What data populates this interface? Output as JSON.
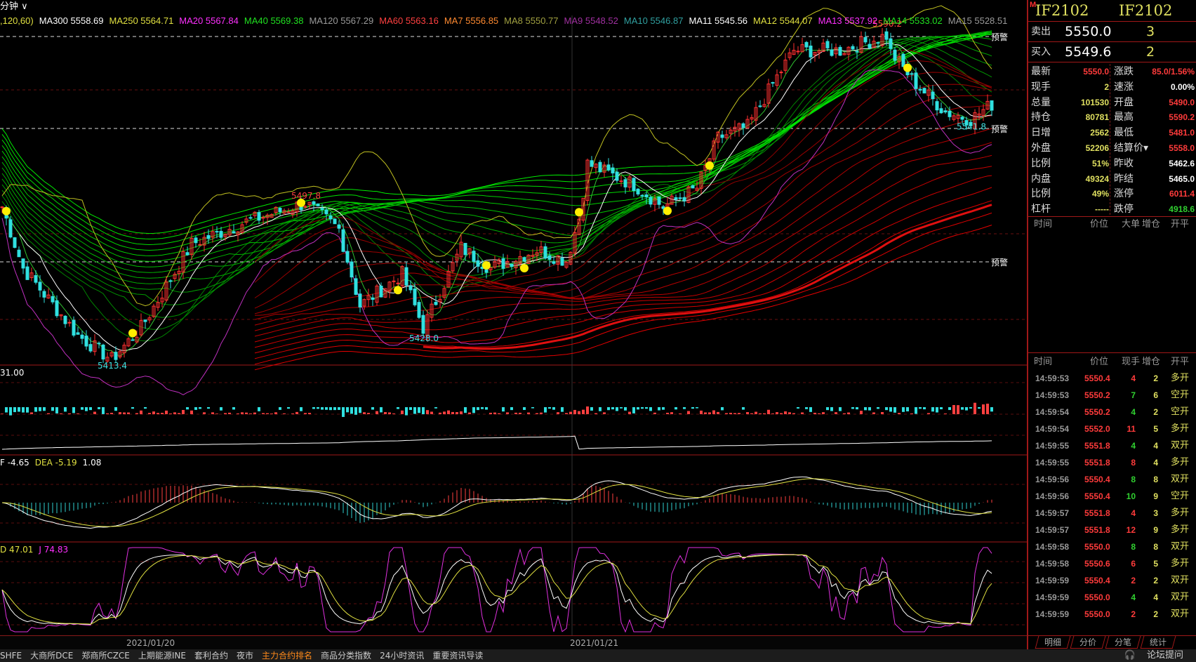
{
  "header": {
    "period": "分钟",
    "period_params": ",120,60)"
  },
  "ma_legend": [
    {
      "label": "MA300 5558.69",
      "color": "#ffffff"
    },
    {
      "label": "MA250 5564.71",
      "color": "#e0e040"
    },
    {
      "label": "MA20 5567.84",
      "color": "#ff30ff"
    },
    {
      "label": "MA40 5569.38",
      "color": "#20e020"
    },
    {
      "label": "MA120 5567.29",
      "color": "#9a9a9a"
    },
    {
      "label": "MA60 5563.16",
      "color": "#ff4040"
    },
    {
      "label": "MA7 5556.85",
      "color": "#ff8a30"
    },
    {
      "label": "MA8 5550.77",
      "color": "#a0a040"
    },
    {
      "label": "MA9 5548.52",
      "color": "#a030a0"
    },
    {
      "label": "MA10 5546.87",
      "color": "#30a0a0"
    },
    {
      "label": "MA11 5545.56",
      "color": "#ffffff"
    },
    {
      "label": "MA12 5544.07",
      "color": "#e0e040"
    },
    {
      "label": "MA13 5537.92",
      "color": "#ff30ff"
    },
    {
      "label": "MA14 5533.02",
      "color": "#20e020"
    },
    {
      "label": "MA15 5528.51",
      "color": "#9a9a9a"
    }
  ],
  "chart_data": {
    "type": "candlestick",
    "anchors": [
      [
        0,
        5495
      ],
      [
        5,
        5462
      ],
      [
        18,
        5426
      ],
      [
        26,
        5413
      ],
      [
        33,
        5430
      ],
      [
        45,
        5475
      ],
      [
        58,
        5487
      ],
      [
        72,
        5497
      ],
      [
        80,
        5483
      ],
      [
        85,
        5442
      ],
      [
        95,
        5459
      ],
      [
        100,
        5430
      ],
      [
        109,
        5473
      ],
      [
        116,
        5462
      ],
      [
        127,
        5472
      ],
      [
        134,
        5466
      ],
      [
        137,
        5489
      ],
      [
        139,
        5518
      ],
      [
        150,
        5507
      ],
      [
        157,
        5495
      ],
      [
        165,
        5505
      ],
      [
        170,
        5532
      ],
      [
        177,
        5538
      ],
      [
        183,
        5561
      ],
      [
        188,
        5579
      ],
      [
        199,
        5579
      ],
      [
        210,
        5587
      ],
      [
        211,
        5578
      ],
      [
        217,
        5561
      ],
      [
        224,
        5546
      ],
      [
        230,
        5542
      ],
      [
        235,
        5550
      ]
    ],
    "price_range": [
      5400,
      5600
    ],
    "annotations": [
      "5590.2",
      "5497.8",
      "5428.0",
      "5413.4",
      "5541.8"
    ],
    "alerts": [
      "预警",
      "预警",
      "预警"
    ],
    "dates": [
      "2021/01/20",
      "2021/01/21"
    ],
    "volume_label": "31.00",
    "macd_label": [
      {
        "t": "F -4.65",
        "c": "#ffffff"
      },
      {
        "t": "DEA -5.19",
        "c": "#e0e040"
      },
      {
        "t": "1.08",
        "c": "#ffffff"
      }
    ],
    "kdj_label": [
      {
        "t": "D 47.01",
        "c": "#e0e040"
      },
      {
        "t": "J 74.83",
        "c": "#ff30ff"
      }
    ]
  },
  "right_panel": {
    "marker": "M",
    "code1": "IF2102",
    "code2": "IF2102",
    "sell": {
      "label": "卖出",
      "price": "5550.0",
      "vol": "3"
    },
    "buy": {
      "label": "买入",
      "price": "5549.6",
      "vol": "2"
    },
    "info": [
      {
        "a": "最新",
        "b": "5550.0",
        "bc": "#ff3b3b",
        "c": "涨跌",
        "d": "85.0/1.56%",
        "dc": "#ff3b3b"
      },
      {
        "a": "现手",
        "b": "2",
        "bc": "#e0e060",
        "c": "速涨",
        "d": "0.00%",
        "dc": "#ffffff"
      },
      {
        "a": "总量",
        "b": "101530",
        "bc": "#e0e060",
        "c": "开盘",
        "d": "5490.0",
        "dc": "#ff3b3b"
      },
      {
        "a": "持仓",
        "b": "80781",
        "bc": "#e0e060",
        "c": "最高",
        "d": "5590.2",
        "dc": "#ff3b3b"
      },
      {
        "a": "日增",
        "b": "2562",
        "bc": "#e0e060",
        "c": "最低",
        "d": "5481.0",
        "dc": "#ff3b3b"
      },
      {
        "a": "外盘",
        "b": "52206",
        "bc": "#e0e060",
        "c": "结算价▾",
        "d": "5558.0",
        "dc": "#ff3b3b"
      },
      {
        "a": "比例",
        "b": "51%",
        "bc": "#e0e060",
        "c": "昨收",
        "d": "5462.6",
        "dc": "#ffffff"
      },
      {
        "a": "内盘",
        "b": "49324",
        "bc": "#e0e060",
        "c": "昨结",
        "d": "5465.0",
        "dc": "#ffffff"
      },
      {
        "a": "比例",
        "b": "49%",
        "bc": "#e0e060",
        "c": "涨停",
        "d": "6011.4",
        "dc": "#ff3b3b"
      },
      {
        "a": "杠杆",
        "b": "-----",
        "bc": "#e0e060",
        "c": "跌停",
        "d": "4918.6",
        "dc": "#30d030"
      }
    ],
    "bigorder_headers": [
      "时间",
      "价位",
      "大单",
      "增仓",
      "开平"
    ],
    "tick_headers": [
      "时间",
      "价位",
      "现手",
      "增仓",
      "开平"
    ],
    "ticks": [
      [
        "14:59:53",
        "5550.4",
        "4",
        "2",
        "多开",
        "#ff3b3b"
      ],
      [
        "14:59:53",
        "5550.2",
        "7",
        "6",
        "空开",
        "#30d030"
      ],
      [
        "14:59:54",
        "5550.2",
        "4",
        "2",
        "空开",
        "#30d030"
      ],
      [
        "14:59:54",
        "5552.0",
        "11",
        "5",
        "多开",
        "#ff3b3b"
      ],
      [
        "14:59:55",
        "5551.8",
        "4",
        "4",
        "双开",
        "#30d030"
      ],
      [
        "14:59:55",
        "5551.8",
        "8",
        "4",
        "多开",
        "#ff3b3b"
      ],
      [
        "14:59:56",
        "5550.4",
        "8",
        "8",
        "双开",
        "#30d030"
      ],
      [
        "14:59:56",
        "5550.4",
        "10",
        "9",
        "空开",
        "#30d030"
      ],
      [
        "14:59:57",
        "5551.8",
        "4",
        "3",
        "多开",
        "#ff3b3b"
      ],
      [
        "14:59:57",
        "5551.8",
        "12",
        "9",
        "多开",
        "#ff3b3b"
      ],
      [
        "14:59:58",
        "5550.0",
        "8",
        "8",
        "双开",
        "#30d030"
      ],
      [
        "14:59:58",
        "5550.6",
        "6",
        "5",
        "多开",
        "#ff3b3b"
      ],
      [
        "14:59:59",
        "5550.4",
        "2",
        "2",
        "双开",
        "#ff3b3b"
      ],
      [
        "14:59:59",
        "5550.0",
        "4",
        "4",
        "双开",
        "#30d030"
      ],
      [
        "14:59:59",
        "5550.0",
        "2",
        "2",
        "双开",
        "#ff3b3b"
      ]
    ],
    "tabs": [
      "明细",
      "分价",
      "分笔",
      "统计"
    ]
  },
  "bottom_bar": {
    "items": [
      "SHFE",
      "大商所DCE",
      "郑商所CZCE",
      "上期能源INE",
      "套利合约",
      "夜市",
      "主力合约排名",
      "商品分类指数",
      "24小时资讯",
      "重要资讯导读"
    ],
    "active_index": 6,
    "forum": "论坛提问"
  }
}
